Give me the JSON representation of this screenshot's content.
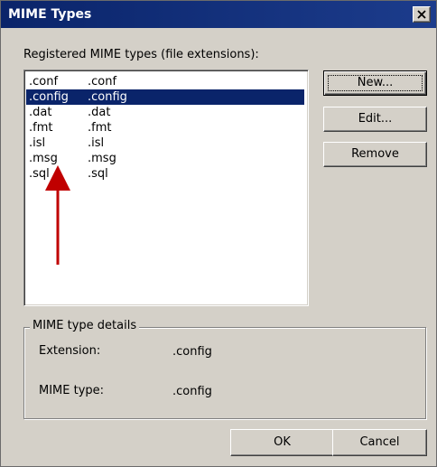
{
  "window": {
    "title": "MIME Types"
  },
  "list": {
    "caption": "Registered MIME types (file extensions):",
    "selected_index": 1,
    "items": [
      {
        "extension": ".conf",
        "mime_type": ".conf"
      },
      {
        "extension": ".config",
        "mime_type": ".config"
      },
      {
        "extension": ".dat",
        "mime_type": ".dat"
      },
      {
        "extension": ".fmt",
        "mime_type": ".fmt"
      },
      {
        "extension": ".isl",
        "mime_type": ".isl"
      },
      {
        "extension": ".msg",
        "mime_type": ".msg"
      },
      {
        "extension": ".sql",
        "mime_type": ".sql"
      }
    ]
  },
  "buttons": {
    "new_label": "New...",
    "edit_label": "Edit...",
    "remove_label": "Remove",
    "ok_label": "OK",
    "cancel_label": "Cancel"
  },
  "details": {
    "group_label": "MIME type details",
    "extension_label": "Extension:",
    "extension_value": ".config",
    "mime_type_label": "MIME type:",
    "mime_type_value": ".config"
  },
  "colors": {
    "title_bar": "#0a246a",
    "selection": "#0a246a",
    "annotation_arrow": "#c00000"
  },
  "icons": {
    "close": "close-icon",
    "annotation": "arrow-up-icon"
  }
}
